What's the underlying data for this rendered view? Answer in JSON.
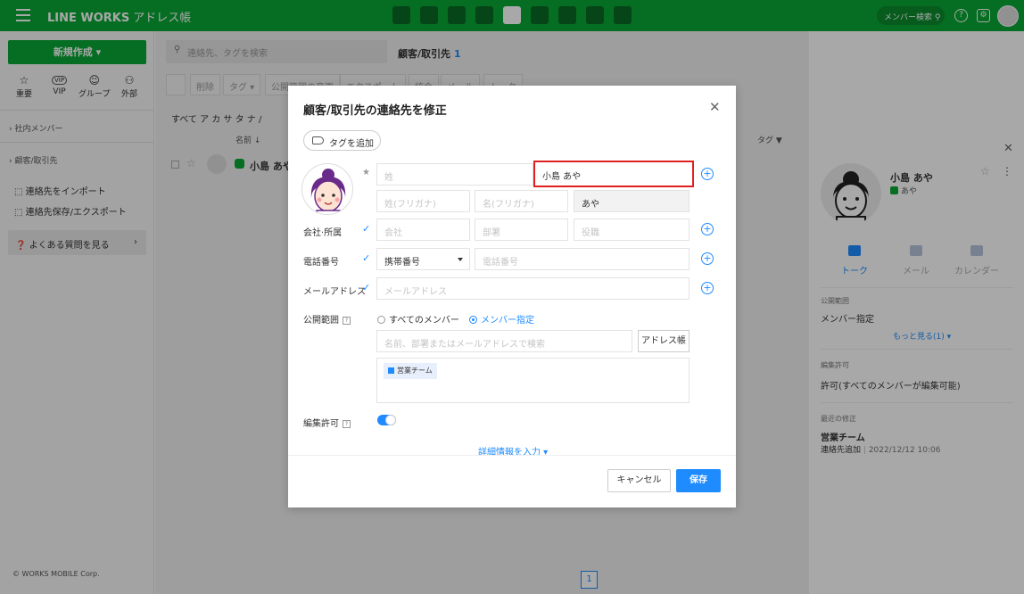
{
  "header": {
    "brand": "LINE WORKS",
    "app_name": "アドレス帳",
    "member_search": "メンバー検索",
    "apps": [
      "notes",
      "talk",
      "mail",
      "calendar",
      "contacts",
      "drive",
      "tasks",
      "survey",
      "plugin"
    ]
  },
  "sidebar": {
    "new_button": "新規作成",
    "quick": [
      {
        "label": "重要",
        "icon": "star-icon"
      },
      {
        "label": "VIP",
        "icon": "vip-icon"
      },
      {
        "label": "グループ",
        "icon": "group-icon"
      },
      {
        "label": "外部",
        "icon": "external-icon"
      }
    ],
    "sections": [
      "社内メンバー",
      "顧客/取引先"
    ],
    "links": [
      "連絡先をインポート",
      "連絡先保存/エクスポート"
    ],
    "faq": "よくある質問を見る",
    "copyright": "© WORKS MOBILE Corp."
  },
  "main": {
    "search_placeholder": "連絡先、タグを検索",
    "breadcrumb": "顧客/取引先",
    "count": "1",
    "toolbar": [
      "削除",
      "タグ",
      "公開範囲の変更",
      "エクスポート",
      "統合",
      "メール",
      "トーク"
    ],
    "alphabet": "すべて ア カ サ タ ナ /",
    "col_name": "名前 ↓",
    "col_tag": "タグ",
    "row_name": "小島 あや",
    "page": "1"
  },
  "detail": {
    "name": "小島 あや",
    "sub": "あや",
    "actions": [
      "トーク",
      "メール",
      "カレンダー"
    ],
    "scope_label": "公開範囲",
    "scope_value": "メンバー指定",
    "more": "もっと見る(1)",
    "edit_label": "編集許可",
    "edit_value": "許可(すべてのメンバーが編集可能)",
    "recent_label": "最近の修正",
    "recent_team": "営業チーム",
    "recent_action": "連絡先追加",
    "recent_time": "2022/12/12 10:06"
  },
  "modal": {
    "title": "顧客/取引先の連絡先を修正",
    "tag_button": "タグを追加",
    "name": {
      "last_placeholder": "姓",
      "full_value": "小島 あや",
      "last_kana_placeholder": "姓(フリガナ)",
      "first_kana_placeholder": "名(フリガナ)",
      "nickname_value": "あや"
    },
    "company": {
      "label": "会社·所属",
      "company_placeholder": "会社",
      "dept_placeholder": "部署",
      "title_placeholder": "役職"
    },
    "phone": {
      "label": "電話番号",
      "type_value": "携帯番号",
      "placeholder": "電話番号"
    },
    "email": {
      "label": "メールアドレス",
      "placeholder": "メールアドレス"
    },
    "scope": {
      "label": "公開範囲",
      "help": "?",
      "option_all": "すべてのメンバー",
      "option_specified": "メンバー指定",
      "search_placeholder": "名前、部署またはメールアドレスで検索",
      "address_button": "アドレス帳",
      "team_chip": "営業チーム"
    },
    "edit": {
      "label": "編集許可",
      "help": "?"
    },
    "more_link": "詳細情報を入力",
    "cancel": "キャンセル",
    "save": "保存"
  }
}
